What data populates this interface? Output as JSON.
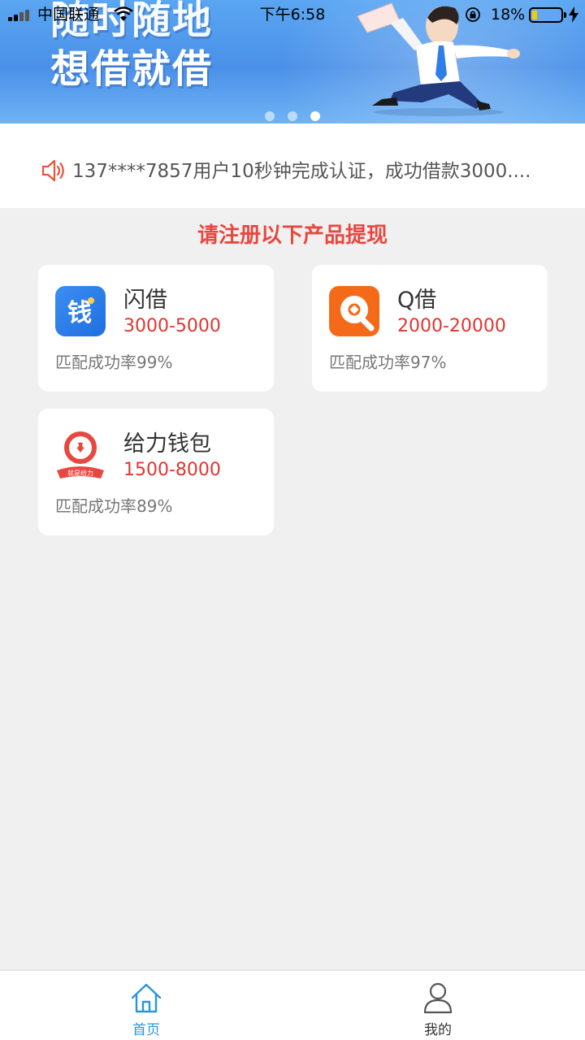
{
  "status_bar": {
    "carrier": "中国联通",
    "time": "下午6:58",
    "battery_percent": "18%",
    "battery_level": 0.18,
    "battery_color": "#f2cc0c"
  },
  "banner": {
    "line1": "随时随地",
    "line2": "想借就借",
    "pages": 3,
    "active_page": 3
  },
  "notice": {
    "icon": "speaker-icon",
    "text": "137****7857用户10秒钟完成认证，成功借款3000...."
  },
  "section": {
    "title": "请注册以下产品提现",
    "title_color": "#e8473f"
  },
  "products": [
    {
      "name": "闪借",
      "range": "3000-5000",
      "rate": "匹配成功率99%",
      "logo_icon": "qian-app-icon",
      "logo_text": "钱",
      "logo_color": "#2f7de9"
    },
    {
      "name": "Q借",
      "range": "2000-20000",
      "rate": "匹配成功率97%",
      "logo_icon": "q-app-icon",
      "logo_color": "#f46a19"
    },
    {
      "name": "给力钱包",
      "range": "1500-8000",
      "rate": "匹配成功率89%",
      "logo_icon": "geili-app-icon",
      "logo_text": "就是给力",
      "logo_color": "#e8473f"
    }
  ],
  "tabbar": {
    "home_label": "首页",
    "mine_label": "我的",
    "active_color": "#2a96d8"
  }
}
